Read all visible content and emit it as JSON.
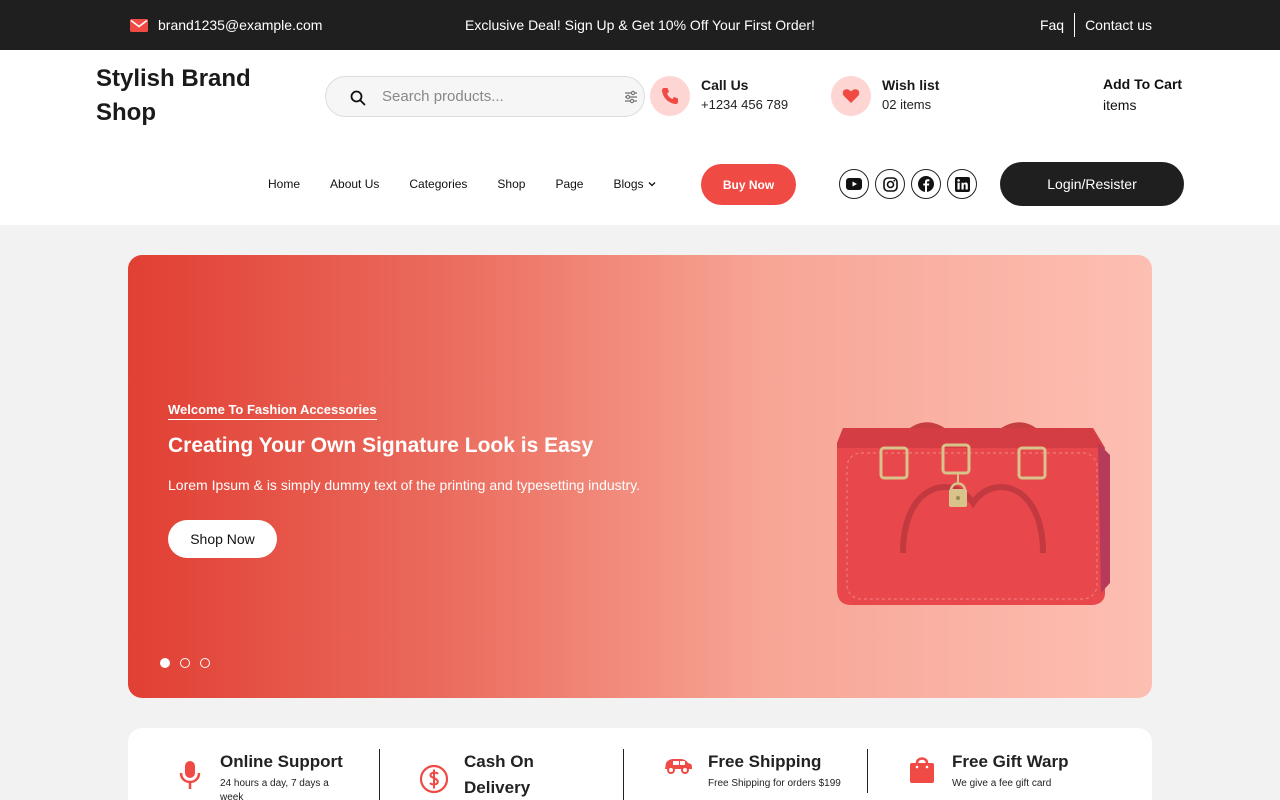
{
  "topbar": {
    "email": "brand1235@example.com",
    "promo": "Exclusive Deal! Sign Up & Get 10% Off Your First Order!",
    "faq": "Faq",
    "contact": "Contact us"
  },
  "header": {
    "brand": "Stylish Brand Shop",
    "search": {
      "placeholder": "Search products..."
    },
    "call": {
      "title": "Call Us",
      "value": "+1234 456 789"
    },
    "wishlist": {
      "title": "Wish list",
      "value": "02 items"
    },
    "cart": {
      "title": "Add To Cart",
      "value": "items"
    }
  },
  "nav": {
    "items": [
      "Home",
      "About Us",
      "Categories",
      "Shop",
      "Page",
      "Blogs"
    ],
    "buy_now": "Buy Now",
    "login": "Login/Resister",
    "socials": [
      "youtube-icon",
      "instagram-icon",
      "facebook-icon",
      "linkedin-icon"
    ]
  },
  "hero": {
    "eyebrow": "Welcome To Fashion Accessories",
    "headline": "Creating Your Own Signature Look is Easy",
    "description": "Lorem Ipsum & is simply dummy text of the printing and typesetting industry.",
    "cta": "Shop Now",
    "slides_total": 3,
    "slide_active": 1
  },
  "features": [
    {
      "icon": "microphone-icon",
      "title": "Online Support",
      "desc": "24 hours a day, 7 days a week"
    },
    {
      "icon": "dollar-icon",
      "title": "Cash On Delivery",
      "desc": ""
    },
    {
      "icon": "car-icon",
      "title": "Free Shipping",
      "desc": "Free Shipping for orders $199"
    },
    {
      "icon": "gift-bag-icon",
      "title": "Free Gift Warp",
      "desc": "We give a fee gift card"
    }
  ],
  "colors": {
    "accent": "#f04a45",
    "dark": "#1f1f1f",
    "pink_circle": "#fdd5d2"
  }
}
